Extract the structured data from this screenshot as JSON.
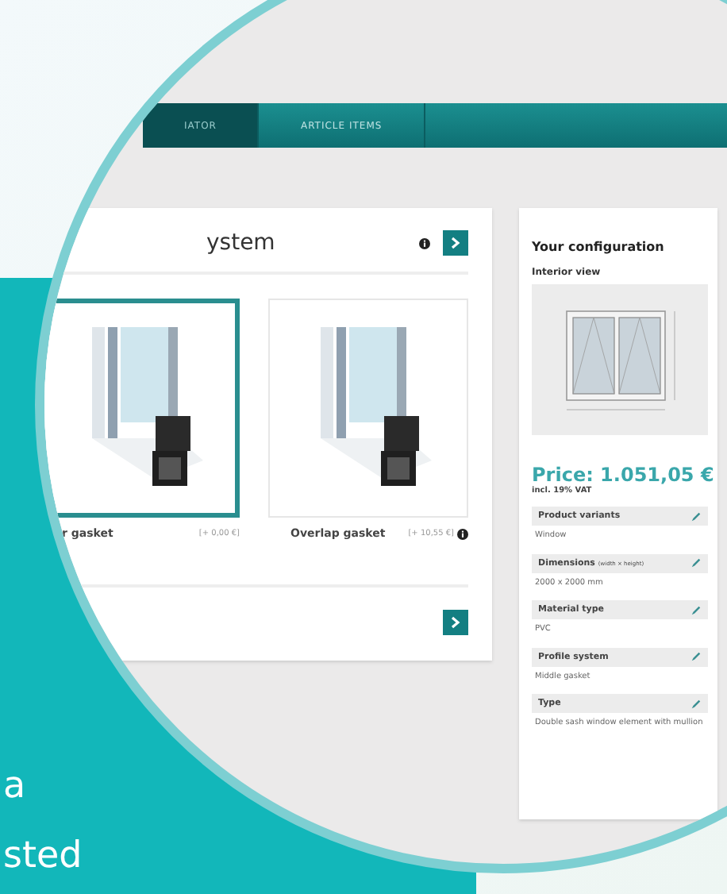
{
  "nav": {
    "tabs": [
      {
        "label": "IATOR",
        "selected": true
      },
      {
        "label": "ARTICLE ITEMS",
        "selected": false
      }
    ]
  },
  "main": {
    "title": "ystem",
    "options": [
      {
        "name": "r gasket",
        "price": "[+ 0,00 €]",
        "selected": true,
        "help": false
      },
      {
        "name": "Overlap gasket",
        "price": "[+ 10,55 €]",
        "selected": false,
        "help": true
      }
    ]
  },
  "config": {
    "title": "Your configuration",
    "view_label": "Interior view",
    "price": "Price: 1.051,05 €",
    "vat": "incl. 19% VAT",
    "items": [
      {
        "label": "Product variants",
        "value": "Window"
      },
      {
        "label": "Dimensions",
        "note": "(width × height)",
        "value": "2000 x 2000 mm"
      },
      {
        "label": "Material type",
        "value": "PVC"
      },
      {
        "label": "Profile system",
        "value": "Middle gasket"
      },
      {
        "label": "Type",
        "value": "Double sash window element with mullion"
      }
    ]
  },
  "banner": {
    "lines": [
      "a",
      "sted"
    ]
  }
}
